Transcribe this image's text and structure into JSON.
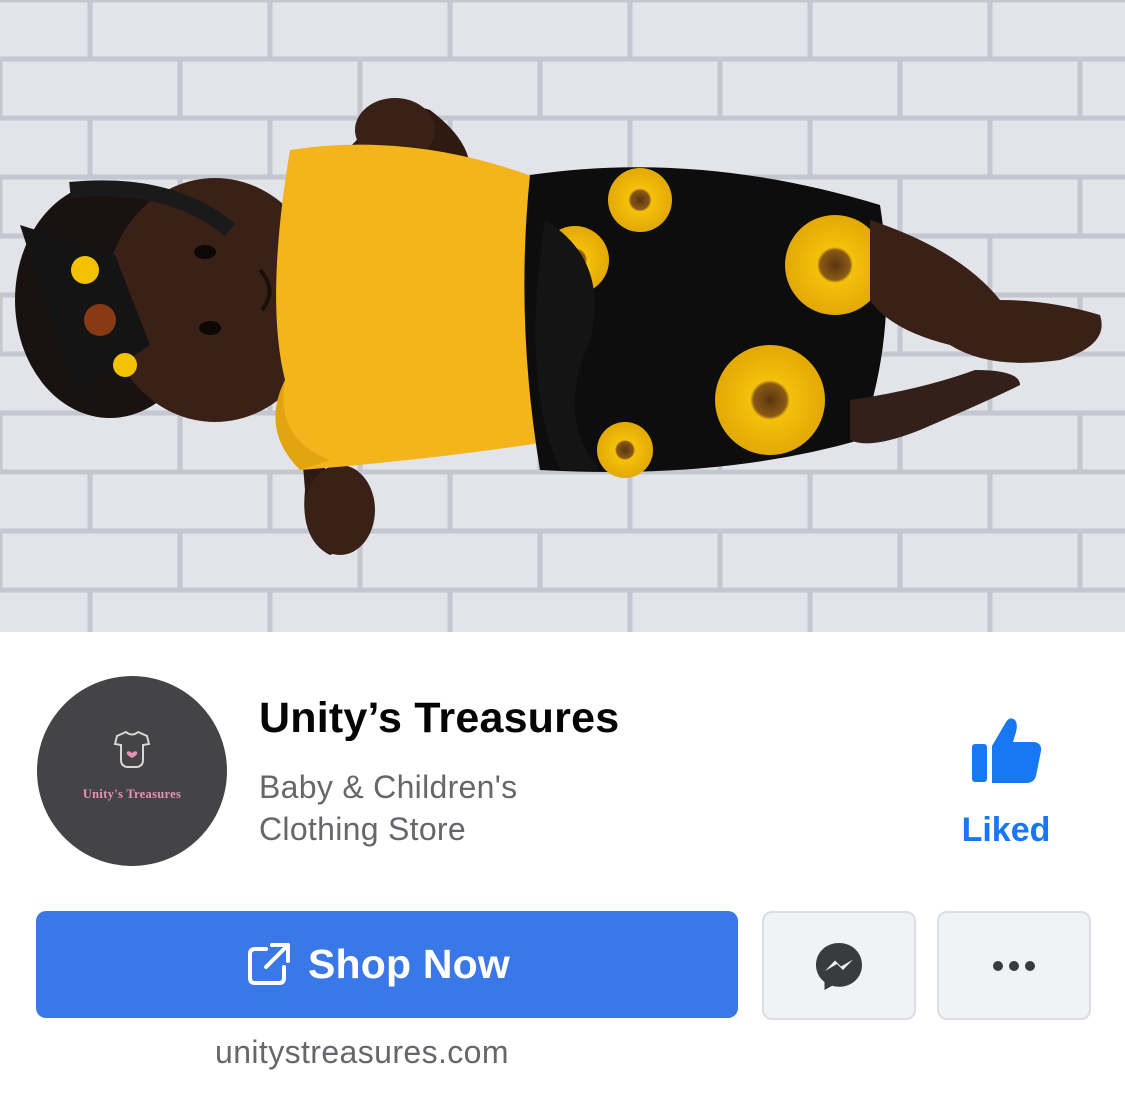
{
  "page": {
    "name": "Unity’s Treasures",
    "category": "Baby & Children's Clothing Store",
    "website": "unitystreasures.com"
  },
  "avatar": {
    "logo_text": "Unity's Treasures",
    "background": "#444446",
    "logo_color": "#e891b4"
  },
  "cover": {
    "icon": "cover-photo"
  },
  "actions": {
    "like_label": "Liked",
    "shop_label": "Shop Now",
    "shop_icon": "external-link-icon",
    "message_icon": "messenger-icon",
    "more_icon": "more-dots-icon"
  },
  "colors": {
    "primary_button": "#3b78e7",
    "liked_blue": "#1877f2",
    "secondary_button": "#f0f2f5",
    "muted_text": "#65676b"
  }
}
